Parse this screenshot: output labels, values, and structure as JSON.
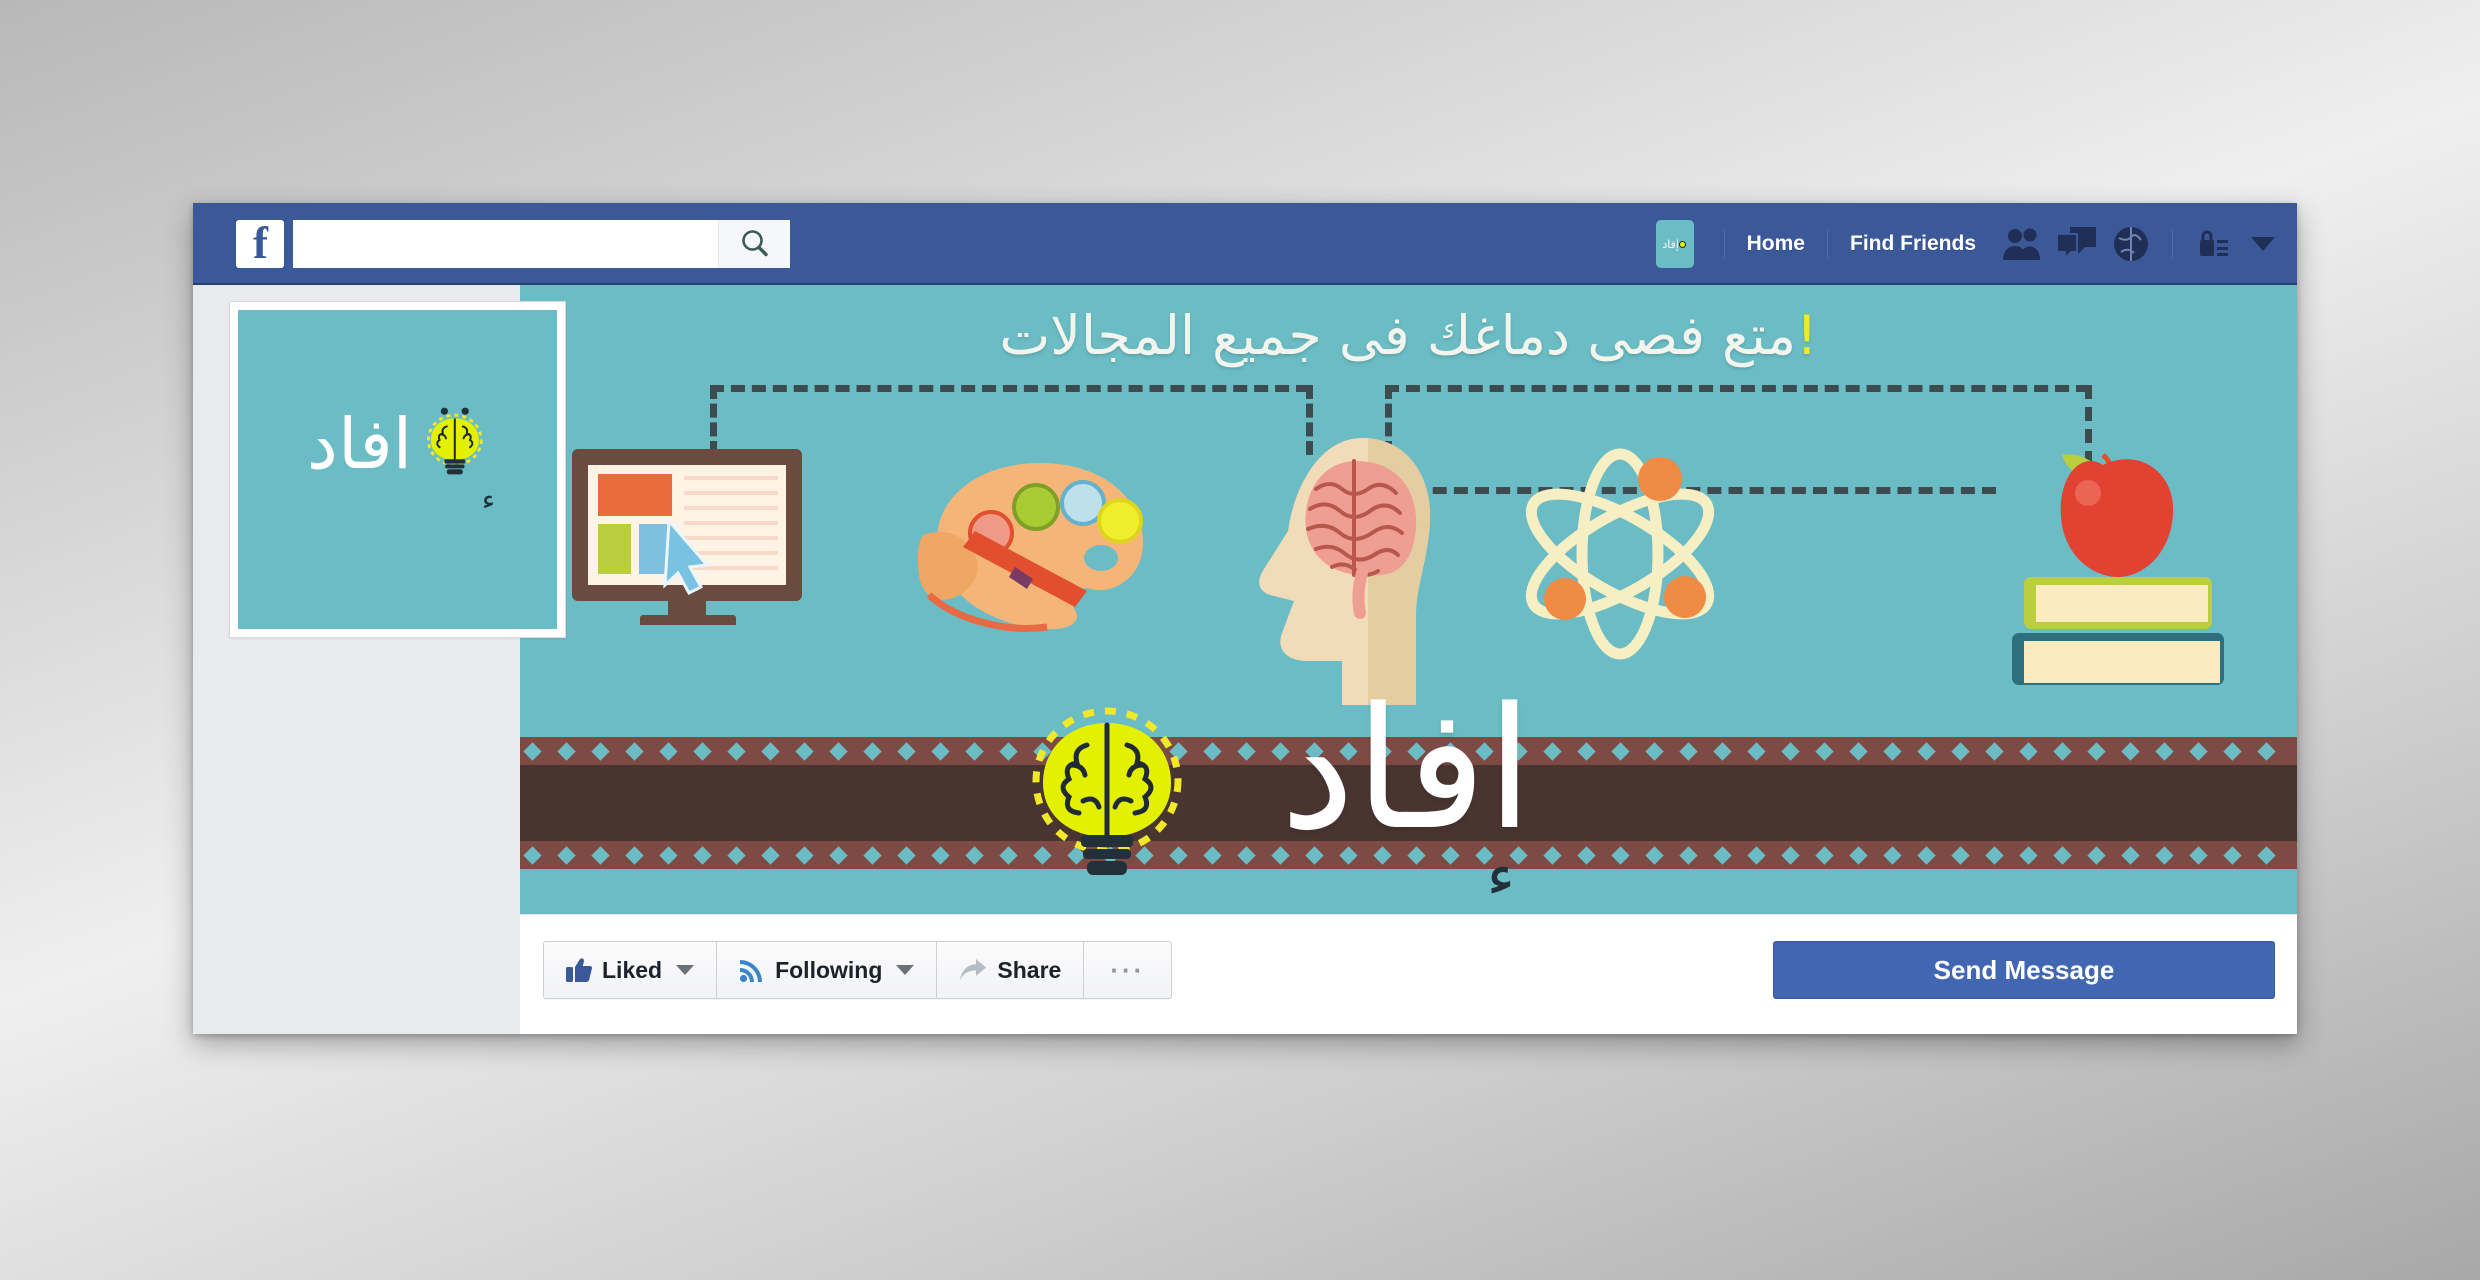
{
  "window": {
    "kind": "facebook-page-profile"
  },
  "topbar": {
    "logo_text": "f",
    "logo_icon": "facebook-logo-icon",
    "search": {
      "value": "",
      "placeholder": "",
      "icon": "search-icon"
    },
    "page_thumb": {
      "label": "إفاد",
      "icon": "brain-bulb-icon"
    },
    "links": [
      {
        "label": "Home"
      },
      {
        "label": "Find Friends"
      }
    ],
    "icons": [
      {
        "name": "friend-requests-icon"
      },
      {
        "name": "messages-icon"
      },
      {
        "name": "notifications-globe-icon"
      },
      {
        "name": "privacy-lock-icon"
      },
      {
        "name": "account-chevron-down-icon"
      }
    ],
    "colors": {
      "bar": "#3b5998",
      "bar_border": "#2a3f6d"
    }
  },
  "profile": {
    "picture": {
      "word": "افاد",
      "hamza": "ء",
      "bg": "#6bbcc4",
      "icon": "brain-bulb-icon"
    }
  },
  "cover": {
    "title": "متع فصى دماغك فى جميع المجالات",
    "title_bang": "!",
    "bg": "#6bbcc4",
    "logo_word": "افاد",
    "logo_hamza": "ء",
    "filmstrip": {
      "outer_color": "#7d4a44",
      "inner_color": "#483530",
      "perforation_color": "#6bbcc4"
    },
    "illustrations": [
      {
        "name": "computer-monitor-icon"
      },
      {
        "name": "cursor-arrow-icon"
      },
      {
        "name": "paint-palette-icon"
      },
      {
        "name": "paint-brush-icon"
      },
      {
        "name": "head-brain-icon"
      },
      {
        "name": "atom-icon"
      },
      {
        "name": "apple-icon"
      },
      {
        "name": "books-stack-icon"
      },
      {
        "name": "brain-bulb-icon"
      }
    ],
    "connector_color": "#3d4a4e"
  },
  "actions": {
    "liked": {
      "label": "Liked",
      "icon": "thumbs-up-icon"
    },
    "following": {
      "label": "Following",
      "icon": "rss-icon"
    },
    "share": {
      "label": "Share",
      "icon": "share-arrow-icon"
    },
    "more": {
      "label": "···",
      "icon": "ellipsis-icon"
    },
    "send_message": {
      "label": "Send Message",
      "color": "#4267b2"
    }
  }
}
